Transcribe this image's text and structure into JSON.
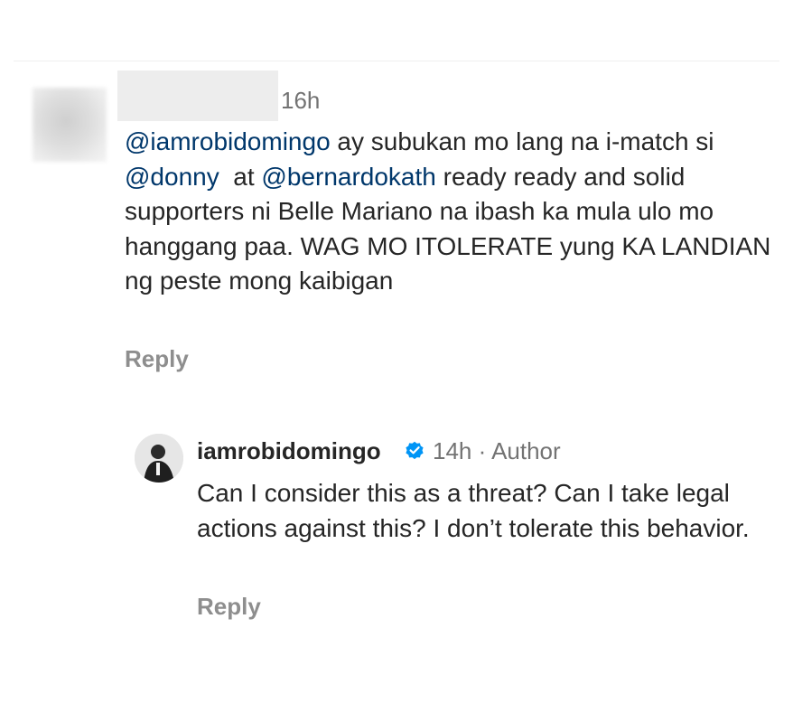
{
  "comment": {
    "time": "16h",
    "segments": [
      {
        "text": "@iamrobidomingo",
        "mention": true
      },
      {
        "text": " ay subukan mo lang na i-match si ",
        "mention": false
      },
      {
        "text": "@donny",
        "mention": true
      },
      {
        "text": "  at ",
        "mention": false
      },
      {
        "text": "@bernardokath",
        "mention": true
      },
      {
        "text": " ready ready and solid supporters ni Belle Mariano na ibash ka mula ulo mo hanggang paa. WAG MO ITOLERATE yung KA LANDIAN ng peste mong kaibigan",
        "mention": false
      }
    ],
    "reply_label": "Reply"
  },
  "reply": {
    "username": "iamrobidomingo",
    "verified_icon": "verified-badge-icon",
    "time": "14h",
    "separator": " · ",
    "role": "Author",
    "text": "Can I consider this as a threat? Can I take legal actions against this? I don’t tolerate this behavior.",
    "reply_label": "Reply"
  },
  "colors": {
    "mention": "#00376b",
    "text": "#262626",
    "muted": "#737373",
    "reply": "#8e8e8e",
    "verified": "#0095f6"
  }
}
